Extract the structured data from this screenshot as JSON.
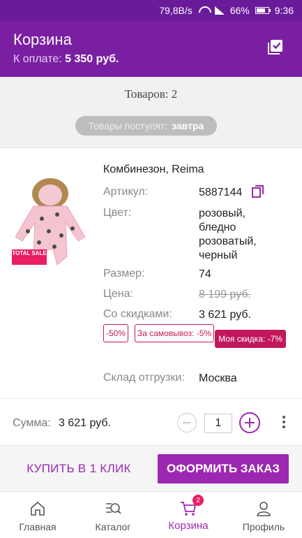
{
  "status_bar": {
    "speed": "79,8B/s",
    "battery": "66%",
    "time": "9:36"
  },
  "header": {
    "title": "Корзина",
    "pay_label": "К оплате:",
    "pay_value": "5 350 руб."
  },
  "cart": {
    "items_count": "Товаров: 2",
    "delivery_label": "Товары поступят:",
    "delivery_value": "завтра"
  },
  "product": {
    "name": "Комбинезон, Reima",
    "badge": "TOTAL SALE",
    "article_label": "Артикул:",
    "article_value": "5887144",
    "color_label": "Цвет:",
    "color_value": [
      "розовый,",
      "бледно",
      "розоватый,",
      "черный"
    ],
    "size_label": "Размер:",
    "size_value": "74",
    "price_label": "Цена:",
    "price_value": "8 199 руб.",
    "discounted_label": "Со скидками:",
    "discounted_value": "3 621 руб.",
    "discounts": [
      "-50%",
      "За самовывоз: -5%",
      "Моя скидка: -7%"
    ],
    "warehouse_label": "Склад отгрузки:",
    "warehouse_value": "Москва"
  },
  "summary": {
    "sum_label": "Сумма:",
    "sum_value": "3 621 руб.",
    "quantity": "1"
  },
  "actions": {
    "buy_one_click": "КУПИТЬ В 1 КЛИК",
    "checkout": "ОФОРМИТЬ ЗАКАЗ"
  },
  "nav": {
    "items": [
      {
        "label": "Главная",
        "icon": "home-icon"
      },
      {
        "label": "Каталог",
        "icon": "catalog-search-icon"
      },
      {
        "label": "Корзина",
        "icon": "cart-icon"
      },
      {
        "label": "Профиль",
        "icon": "profile-icon"
      }
    ],
    "cart_badge": "2"
  },
  "colors": {
    "brand": "#7b1fa2",
    "accent": "#9c27b0",
    "discount": "#c2185b",
    "badge": "#e91e63"
  }
}
